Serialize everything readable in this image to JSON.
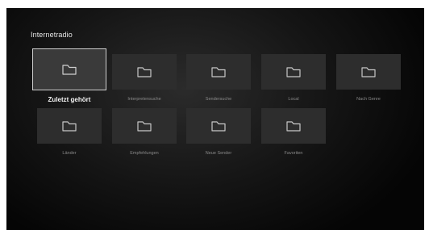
{
  "header": {
    "title": "Internetradio"
  },
  "tiles": [
    {
      "label": "Zuletzt gehört",
      "icon": "folder-icon",
      "selected": true
    },
    {
      "label": "Interpretensuche",
      "icon": "folder-icon",
      "selected": false
    },
    {
      "label": "Sendersuche",
      "icon": "folder-icon",
      "selected": false
    },
    {
      "label": "Local",
      "icon": "folder-icon",
      "selected": false
    },
    {
      "label": "Nach Genre",
      "icon": "folder-icon",
      "selected": false
    },
    {
      "label": "Länder",
      "icon": "folder-icon",
      "selected": false
    },
    {
      "label": "Empfehlungen",
      "icon": "folder-icon",
      "selected": false
    },
    {
      "label": "Neue Sender",
      "icon": "folder-icon",
      "selected": false
    },
    {
      "label": "Favoriten",
      "icon": "folder-icon",
      "selected": false
    }
  ],
  "colors": {
    "tile": "#2d2d2d",
    "tile_selected": "#3a3a3a",
    "selection_border": "#cfcfcf"
  }
}
